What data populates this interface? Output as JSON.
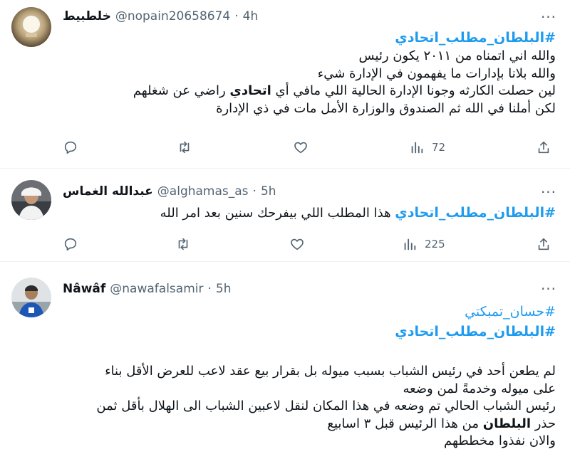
{
  "tweets": [
    {
      "name": "خلطبيط",
      "handle": "@nopain20658674",
      "sep": "·",
      "time": "4h",
      "hashtags": [
        "#البلطان_مطلب_اتحادي"
      ],
      "lines": [
        "والله اني اتمناه من ٢٠١١ يكون رئيس",
        "والله بلانا بإدارات ما يفهمون في الإدارة شيء"
      ],
      "line3_pre": "لين حصلت الكارثه وجونا الإدارة الحالية اللي مافي أي ",
      "line3_bold": "اتحادي",
      "line3_post": " راضي عن شغلهم",
      "line4": "لكن أملنا في الله ثم الصندوق والوزارة الأمل مات في ذي الإدارة",
      "views": "72"
    },
    {
      "name": "عبدالله الغماس",
      "handle": "@alghamas_as",
      "sep": "·",
      "time": "5h",
      "hashtag": "#البلطان_مطلب_اتحادي",
      "text": " هذا المطلب اللي بيفرحك سنين بعد امر الله",
      "views": "225"
    },
    {
      "name": "Nâwâf",
      "handle": "@nawafalsamir",
      "sep": "·",
      "time": "5h",
      "hashtags": [
        "#حسان_تمبكتي",
        "#البلطان_مطلب_اتحادي"
      ],
      "lines": [
        "لم يطعن أحد في رئيس الشباب بسبب ميوله بل بقرار بيع عقد لاعب للعرض الأقل بناء",
        "على ميوله وخدمةً لمن وضعه",
        "رئيس الشباب الحالي تم وضعه في هذا المكان لنقل لاعبين الشباب الى الهلال بأقل ثمن"
      ],
      "line4_pre": "حذر ",
      "line4_bold": "البلطان",
      "line4_post": " من هذا الرئيس قبل ٣ اسابيع",
      "line5": "والان نفذوا مخططهم"
    }
  ],
  "icons": [
    "more-icon",
    "reply-icon",
    "retweet-icon",
    "like-icon",
    "views-icon",
    "share-icon"
  ],
  "colors": {
    "link": "#1d9bf0",
    "secondary": "#536471",
    "text": "#0f1419",
    "border": "#eff3f4"
  }
}
